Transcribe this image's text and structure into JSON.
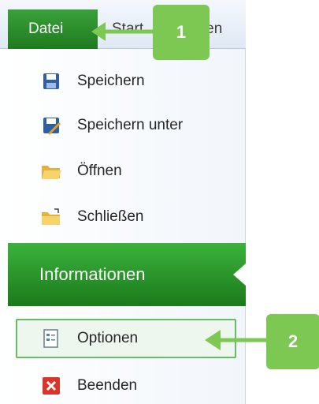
{
  "ribbon": {
    "file_tab": "Datei",
    "start_tab": "Start",
    "insert_tab_fragment": "ugen"
  },
  "menu": {
    "items": [
      {
        "label": "Speichern",
        "icon": "save-icon"
      },
      {
        "label": "Speichern unter",
        "icon": "save-as-icon"
      },
      {
        "label": "Öffnen",
        "icon": "open-folder-icon"
      },
      {
        "label": "Schließen",
        "icon": "close-folder-icon"
      }
    ],
    "info": "Informationen",
    "options": {
      "label": "Optionen",
      "icon": "options-icon"
    },
    "exit": {
      "label": "Beenden",
      "icon": "exit-icon"
    }
  },
  "callouts": {
    "one": "1",
    "two": "2"
  },
  "colors": {
    "accent_green": "#2e8f2e",
    "callout_green": "#7cc852"
  }
}
